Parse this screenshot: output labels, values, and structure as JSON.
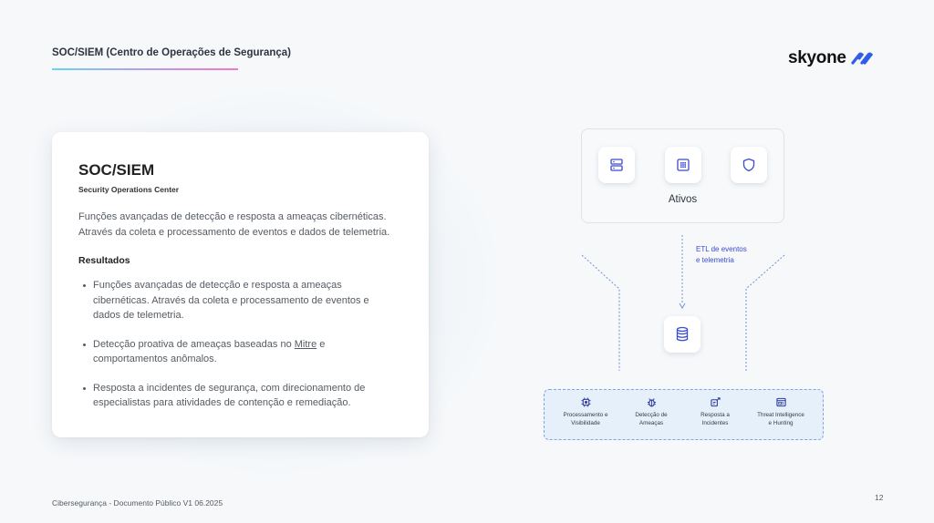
{
  "header": {
    "title": "SOC/SIEM (Centro de Operações de Segurança)"
  },
  "logo": {
    "text": "skyone",
    "icon": "skyone-logo-mark"
  },
  "card": {
    "title": "SOC/SIEM",
    "subtitle": "Security Operations Center",
    "description_lines": [
      "Funções avançadas de detecção e resposta a ameaças cibernéticas.",
      "Através da coleta e processamento de eventos e dados de telemetria."
    ],
    "results_title": "Resultados",
    "results": [
      {
        "text": "Funções avançadas de detecção e resposta a ameaças cibernéticas. Através da coleta e processamento de eventos e dados de telemetria."
      },
      {
        "before": "Detecção proativa de ameaças baseadas no ",
        "link": "Mitre",
        "after": " e comportamentos anômalos."
      },
      {
        "text": "Resposta a incidentes de segurança, com direcionamento de especialistas para atividades de contenção e remediação."
      }
    ]
  },
  "diagram": {
    "assets_label": "Ativos",
    "asset_icons": [
      "server-icon",
      "grid-icon",
      "shield-icon"
    ],
    "etl_label_lines": [
      "ETL de eventos",
      "e telemetria"
    ],
    "database_icon": "database-icon",
    "capabilities": [
      {
        "icon": "chip-icon",
        "lines": [
          "Processamento e",
          "Visibilidade"
        ]
      },
      {
        "icon": "bug-icon",
        "lines": [
          "Detecção de",
          "Ameaças"
        ]
      },
      {
        "icon": "incident-response-icon",
        "lines": [
          "Resposta a",
          "Incidentes"
        ]
      },
      {
        "icon": "browser-icon",
        "lines": [
          "Threat Intelligence",
          "e Hunting"
        ]
      }
    ],
    "accent_color": "#3b4ccf"
  },
  "footer": {
    "text": "Cibersegurança - Documento Público V1 06.2025",
    "page_number": "12"
  }
}
